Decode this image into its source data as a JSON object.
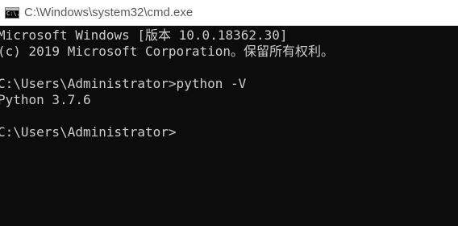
{
  "window": {
    "title": "C:\\Windows\\system32\\cmd.exe",
    "icon": "cmd-icon",
    "icon_glyph": "C:\\."
  },
  "console": {
    "lines": [
      "Microsoft Windows [版本 10.0.18362.30]",
      "(c) 2019 Microsoft Corporation。保留所有权利。",
      "",
      "C:\\Users\\Administrator>python -V",
      "Python 3.7.6",
      "",
      "C:\\Users\\Administrator>"
    ],
    "background": "#0c0c0c",
    "foreground": "#cccccc"
  }
}
